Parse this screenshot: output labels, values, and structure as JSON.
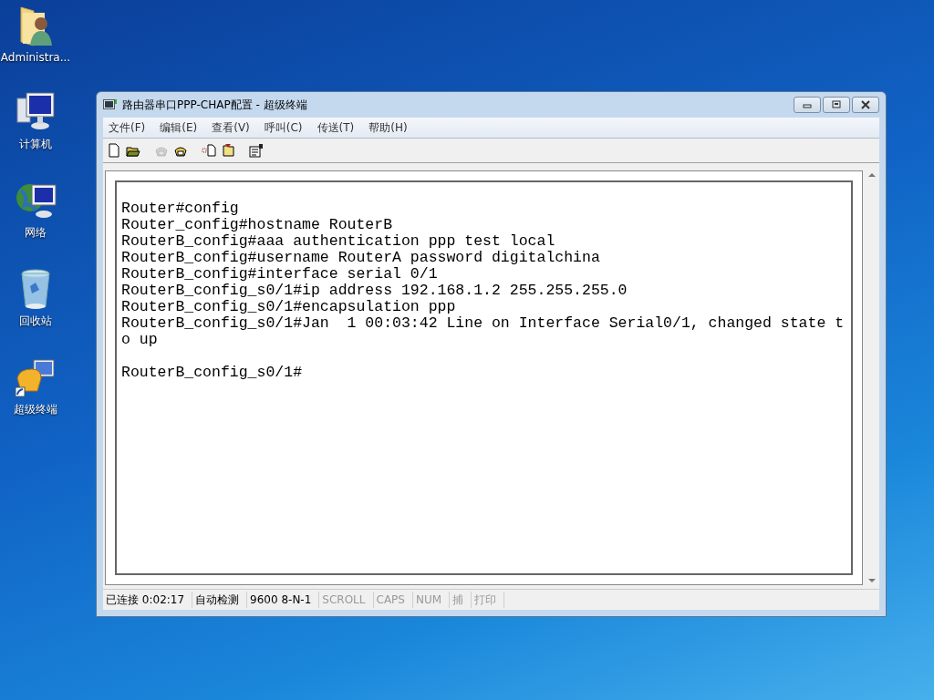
{
  "desktop_icons": [
    {
      "kind": "user-folder",
      "label": "Administra..."
    },
    {
      "kind": "computer",
      "label": "计算机"
    },
    {
      "kind": "network",
      "label": "网络"
    },
    {
      "kind": "recycle-bin",
      "label": "回收站"
    },
    {
      "kind": "terminal-shortcut",
      "label": "超级终端"
    }
  ],
  "window": {
    "title": "路由器串口PPP-CHAP配置 - 超级终端"
  },
  "menu": [
    "文件(F)",
    "编辑(E)",
    "查看(V)",
    "呼叫(C)",
    "传送(T)",
    "帮助(H)"
  ],
  "toolbar": [
    {
      "kind": "new",
      "disabled": false
    },
    {
      "kind": "open",
      "disabled": false
    },
    {
      "kind": "phone",
      "disabled": true
    },
    {
      "kind": "hangup",
      "disabled": false
    },
    {
      "kind": "send",
      "disabled": false
    },
    {
      "kind": "receive",
      "disabled": false
    },
    {
      "kind": "properties",
      "disabled": false
    }
  ],
  "terminal": {
    "lines": [
      {
        "text": "Router#config",
        "blank_before": false
      },
      {
        "text": "Router_config#hostname RouterB",
        "blank_before": false
      },
      {
        "text": "RouterB_config#aaa authentication ppp test local",
        "blank_before": false
      },
      {
        "text": "RouterB_config#username RouterA password digitalchina",
        "blank_before": false
      },
      {
        "text": "RouterB_config#interface serial 0/1",
        "blank_before": false
      },
      {
        "text": "RouterB_config_s0/1#ip address 192.168.1.2 255.255.255.0",
        "blank_before": false
      },
      {
        "text": "RouterB_config_s0/1#encapsulation ppp",
        "blank_before": false
      },
      {
        "text": "RouterB_config_s0/1#Jan  1 00:03:42 Line on Interface Serial0/1, changed state t",
        "blank_before": false
      },
      {
        "text": "o up",
        "blank_before": false
      },
      {
        "text": "RouterB_config_s0/1#",
        "blank_before": true
      }
    ]
  },
  "status_bar": [
    {
      "text": "已连接 0:02:17",
      "disabled": false
    },
    {
      "text": "自动检测",
      "disabled": false
    },
    {
      "text": "9600 8-N-1",
      "disabled": false
    },
    {
      "text": "SCROLL",
      "disabled": true
    },
    {
      "text": "CAPS",
      "disabled": true
    },
    {
      "text": "NUM",
      "disabled": true
    },
    {
      "text": "捕",
      "disabled": true
    },
    {
      "text": "打印",
      "disabled": true
    }
  ]
}
